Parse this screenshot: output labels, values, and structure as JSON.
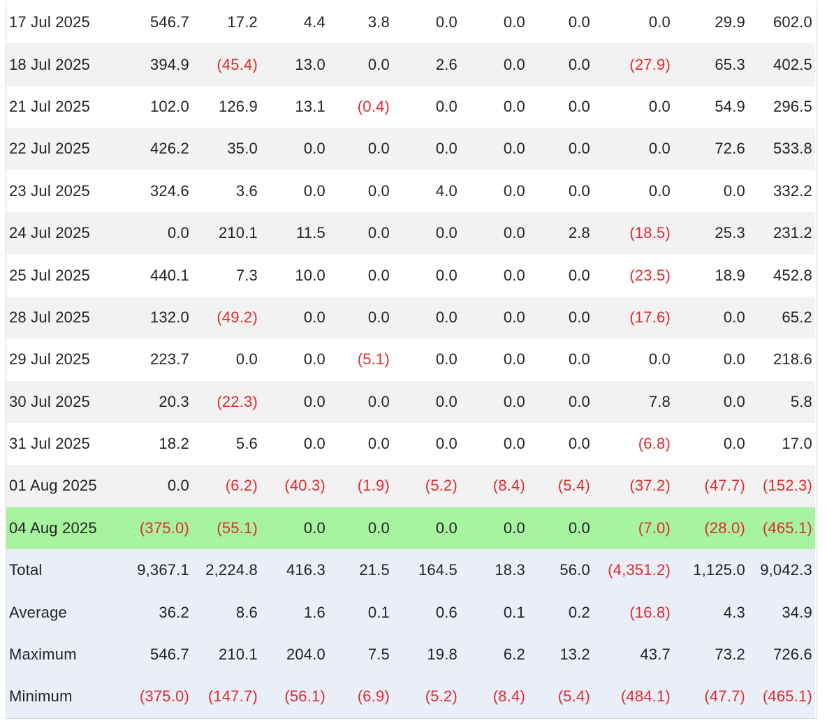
{
  "rows": [
    {
      "date": "17 Jul 2025",
      "values": [
        "546.7",
        "17.2",
        "4.4",
        "3.8",
        "0.0",
        "0.0",
        "0.0",
        "0.0",
        "29.9",
        "602.0"
      ]
    },
    {
      "date": "18 Jul 2025",
      "values": [
        "394.9",
        "(45.4)",
        "13.0",
        "0.0",
        "2.6",
        "0.0",
        "0.0",
        "(27.9)",
        "65.3",
        "402.5"
      ]
    },
    {
      "date": "21 Jul 2025",
      "values": [
        "102.0",
        "126.9",
        "13.1",
        "(0.4)",
        "0.0",
        "0.0",
        "0.0",
        "0.0",
        "54.9",
        "296.5"
      ]
    },
    {
      "date": "22 Jul 2025",
      "values": [
        "426.2",
        "35.0",
        "0.0",
        "0.0",
        "0.0",
        "0.0",
        "0.0",
        "0.0",
        "72.6",
        "533.8"
      ]
    },
    {
      "date": "23 Jul 2025",
      "values": [
        "324.6",
        "3.6",
        "0.0",
        "0.0",
        "4.0",
        "0.0",
        "0.0",
        "0.0",
        "0.0",
        "332.2"
      ]
    },
    {
      "date": "24 Jul 2025",
      "values": [
        "0.0",
        "210.1",
        "11.5",
        "0.0",
        "0.0",
        "0.0",
        "2.8",
        "(18.5)",
        "25.3",
        "231.2"
      ]
    },
    {
      "date": "25 Jul 2025",
      "values": [
        "440.1",
        "7.3",
        "10.0",
        "0.0",
        "0.0",
        "0.0",
        "0.0",
        "(23.5)",
        "18.9",
        "452.8"
      ]
    },
    {
      "date": "28 Jul 2025",
      "values": [
        "132.0",
        "(49.2)",
        "0.0",
        "0.0",
        "0.0",
        "0.0",
        "0.0",
        "(17.6)",
        "0.0",
        "65.2"
      ]
    },
    {
      "date": "29 Jul 2025",
      "values": [
        "223.7",
        "0.0",
        "0.0",
        "(5.1)",
        "0.0",
        "0.0",
        "0.0",
        "0.0",
        "0.0",
        "218.6"
      ]
    },
    {
      "date": "30 Jul 2025",
      "values": [
        "20.3",
        "(22.3)",
        "0.0",
        "0.0",
        "0.0",
        "0.0",
        "0.0",
        "7.8",
        "0.0",
        "5.8"
      ]
    },
    {
      "date": "31 Jul 2025",
      "values": [
        "18.2",
        "5.6",
        "0.0",
        "0.0",
        "0.0",
        "0.0",
        "0.0",
        "(6.8)",
        "0.0",
        "17.0"
      ]
    },
    {
      "date": "01 Aug 2025",
      "values": [
        "0.0",
        "(6.2)",
        "(40.3)",
        "(1.9)",
        "(5.2)",
        "(8.4)",
        "(5.4)",
        "(37.2)",
        "(47.7)",
        "(152.3)"
      ]
    },
    {
      "date": "04 Aug 2025",
      "values": [
        "(375.0)",
        "(55.1)",
        "0.0",
        "0.0",
        "0.0",
        "0.0",
        "0.0",
        "(7.0)",
        "(28.0)",
        "(465.1)"
      ],
      "highlight": true
    }
  ],
  "summary": [
    {
      "label": "Total",
      "values": [
        "9,367.1",
        "2,224.8",
        "416.3",
        "21.5",
        "164.5",
        "18.3",
        "56.0",
        "(4,351.2)",
        "1,125.0",
        "9,042.3"
      ]
    },
    {
      "label": "Average",
      "values": [
        "36.2",
        "8.6",
        "1.6",
        "0.1",
        "0.6",
        "0.1",
        "0.2",
        "(16.8)",
        "4.3",
        "34.9"
      ]
    },
    {
      "label": "Maximum",
      "values": [
        "546.7",
        "210.1",
        "204.0",
        "7.5",
        "19.8",
        "6.2",
        "13.2",
        "43.7",
        "73.2",
        "726.6"
      ]
    },
    {
      "label": "Minimum",
      "values": [
        "(375.0)",
        "(147.7)",
        "(56.1)",
        "(6.9)",
        "(5.2)",
        "(8.4)",
        "(5.4)",
        "(484.1)",
        "(47.7)",
        "(465.1)"
      ]
    }
  ],
  "colors": {
    "negative": "#e02b2b",
    "text": "#222222",
    "row_alt": "#f2f2f2",
    "highlight": "#a6f3a0",
    "summary_bg": "#e9eef9"
  }
}
